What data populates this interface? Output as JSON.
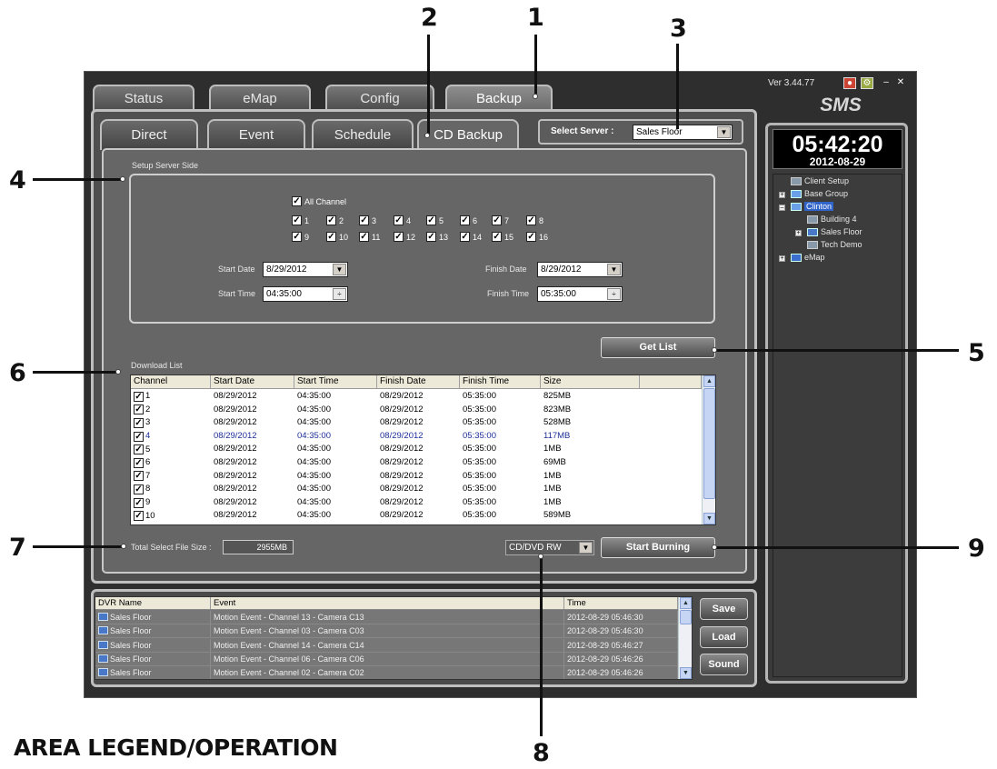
{
  "app": {
    "version": "Ver 3.44.77",
    "brand": "SMS",
    "main_tabs": [
      "Status",
      "eMap",
      "Config",
      "Backup"
    ],
    "sub_tabs": [
      "Direct",
      "Event",
      "Schedule",
      "CD Backup"
    ],
    "select_server_label": "Select Server :",
    "select_server_value": "Sales Floor"
  },
  "setup": {
    "section_label": "Setup Server Side",
    "all_channel_label": "All Channel",
    "channels_row1": [
      "1",
      "2",
      "3",
      "4",
      "5",
      "6",
      "7",
      "8"
    ],
    "channels_row2": [
      "9",
      "10",
      "11",
      "12",
      "13",
      "14",
      "15",
      "16"
    ],
    "start_date_label": "Start Date",
    "start_date": "8/29/2012",
    "start_time_label": "Start Time",
    "start_time": "04:35:00",
    "finish_date_label": "Finish Date",
    "finish_date": "8/29/2012",
    "finish_time_label": "Finish Time",
    "finish_time": "05:35:00"
  },
  "get_list_label": "Get List",
  "download_list": {
    "label": "Download List",
    "columns": [
      "Channel",
      "Start Date",
      "Start Time",
      "Finish Date",
      "Finish Time",
      "Size"
    ],
    "rows": [
      [
        "1",
        "08/29/2012",
        "04:35:00",
        "08/29/2012",
        "05:35:00",
        "825MB"
      ],
      [
        "2",
        "08/29/2012",
        "04:35:00",
        "08/29/2012",
        "05:35:00",
        "823MB"
      ],
      [
        "3",
        "08/29/2012",
        "04:35:00",
        "08/29/2012",
        "05:35:00",
        "528MB"
      ],
      [
        "4",
        "08/29/2012",
        "04:35:00",
        "08/29/2012",
        "05:35:00",
        "117MB"
      ],
      [
        "5",
        "08/29/2012",
        "04:35:00",
        "08/29/2012",
        "05:35:00",
        "1MB"
      ],
      [
        "6",
        "08/29/2012",
        "04:35:00",
        "08/29/2012",
        "05:35:00",
        "69MB"
      ],
      [
        "7",
        "08/29/2012",
        "04:35:00",
        "08/29/2012",
        "05:35:00",
        "1MB"
      ],
      [
        "8",
        "08/29/2012",
        "04:35:00",
        "08/29/2012",
        "05:35:00",
        "1MB"
      ],
      [
        "9",
        "08/29/2012",
        "04:35:00",
        "08/29/2012",
        "05:35:00",
        "1MB"
      ],
      [
        "10",
        "08/29/2012",
        "04:35:00",
        "08/29/2012",
        "05:35:00",
        "589MB"
      ]
    ]
  },
  "total_size_label": "Total Select File Size :",
  "total_size_value": "2955MB",
  "drive_value": "CD/DVD RW",
  "start_burning_label": "Start Burning",
  "event_log": {
    "columns": [
      "DVR Name",
      "Event",
      "Time"
    ],
    "rows": [
      [
        "Sales Floor",
        "Motion Event - Channel 13 - Camera C13",
        "2012-08-29 05:46:30"
      ],
      [
        "Sales Floor",
        "Motion Event - Channel 03 - Camera C03",
        "2012-08-29 05:46:30"
      ],
      [
        "Sales Floor",
        "Motion Event - Channel 14 - Camera C14",
        "2012-08-29 05:46:27"
      ],
      [
        "Sales Floor",
        "Motion Event - Channel 06 - Camera C06",
        "2012-08-29 05:46:26"
      ],
      [
        "Sales Floor",
        "Motion Event - Channel 02 - Camera C02",
        "2012-08-29 05:46:26"
      ]
    ],
    "buttons": [
      "Save",
      "Load",
      "Sound"
    ]
  },
  "clock": {
    "time": "05:42:20",
    "date": "2012-08-29"
  },
  "tree": {
    "client_setup": "Client Setup",
    "base_group": "Base Group",
    "clinton": "Clinton",
    "building4": "Building 4",
    "sales_floor": "Sales Floor",
    "tech_demo": "Tech Demo",
    "emap": "eMap"
  },
  "callouts": [
    "1",
    "2",
    "3",
    "4",
    "5",
    "6",
    "7",
    "8",
    "9"
  ],
  "legend_title": "AREA LEGEND/OPERATION"
}
